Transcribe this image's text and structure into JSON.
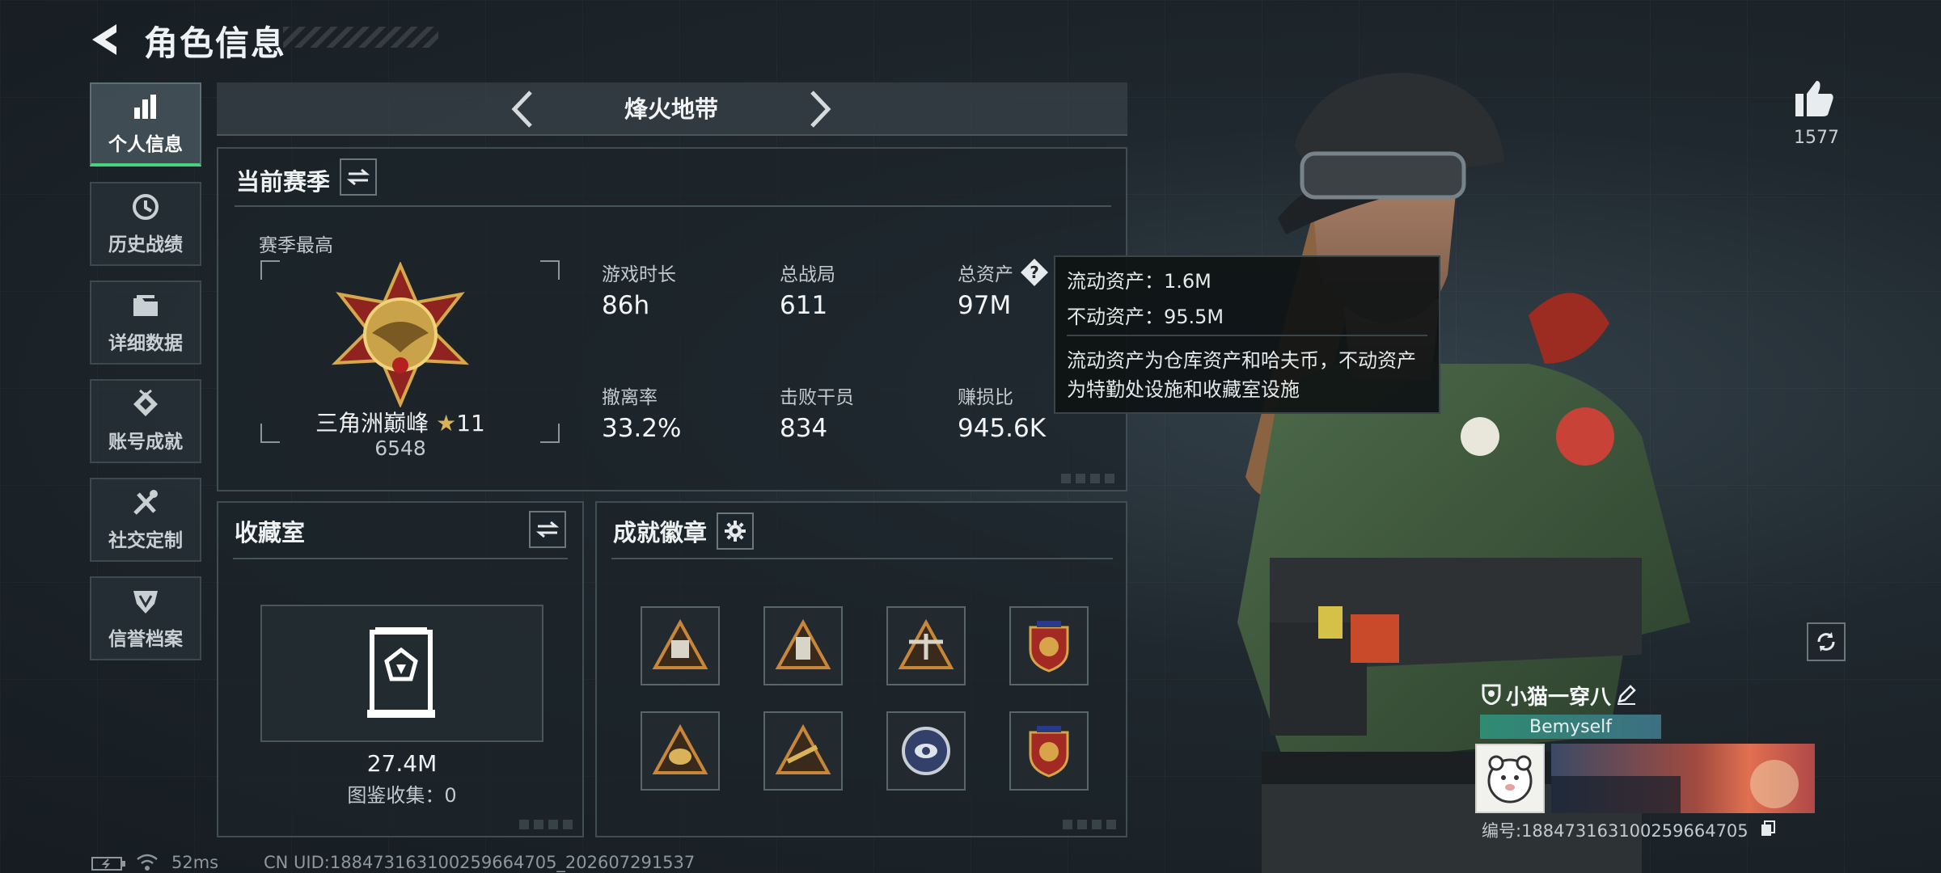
{
  "header": {
    "title": "角色信息"
  },
  "sidebar": {
    "items": [
      {
        "label": "个人信息",
        "icon": "bar-chart-icon"
      },
      {
        "label": "历史战绩",
        "icon": "history-clock-icon"
      },
      {
        "label": "详细数据",
        "icon": "folder-icon"
      },
      {
        "label": "账号成就",
        "icon": "achievement-medal-icon"
      },
      {
        "label": "社交定制",
        "icon": "tools-icon"
      },
      {
        "label": "信誉档案",
        "icon": "shield-emblem-icon"
      }
    ]
  },
  "mode_selector": {
    "current": "烽火地带"
  },
  "season": {
    "title": "当前赛季",
    "best_label": "赛季最高",
    "rank_name": "三角洲巅峰",
    "rank_stars": "11",
    "rank_score": "6548",
    "stats": [
      {
        "label": "游戏时长",
        "value": "86h"
      },
      {
        "label": "总战局",
        "value": "611"
      },
      {
        "label": "总资产",
        "value": "97M"
      },
      {
        "label": "撤离率",
        "value": "33.2%"
      },
      {
        "label": "击败干员",
        "value": "834"
      },
      {
        "label": "赚损比",
        "value": "945.6K"
      }
    ]
  },
  "tooltip": {
    "liquid": "流动资产：1.6M",
    "fixed": "不动资产：95.5M",
    "desc_line1": "流动资产为仓库资产和哈夫币，不动资产",
    "desc_line2": "为特勤处设施和收藏室设施"
  },
  "collection": {
    "title": "收藏室",
    "value": "27.4M",
    "catalog": "图鉴收集：0"
  },
  "achievements": {
    "title": "成就徽章",
    "badges": [
      "badge-1",
      "badge-2",
      "badge-3",
      "badge-4",
      "badge-5",
      "badge-6",
      "badge-7",
      "badge-8"
    ]
  },
  "likes": {
    "count": "1577"
  },
  "profile": {
    "name": "小猫一穿八",
    "tag": "Bemyself",
    "id": "编号:188473163100259664705"
  },
  "footer": {
    "ping": "52ms",
    "uid": "CN UID:188473163100259664705_202607291537"
  },
  "colors": {
    "accent": "#46d27e",
    "tooltip_bg": "#0e1214",
    "panel_border": "#404d54"
  }
}
